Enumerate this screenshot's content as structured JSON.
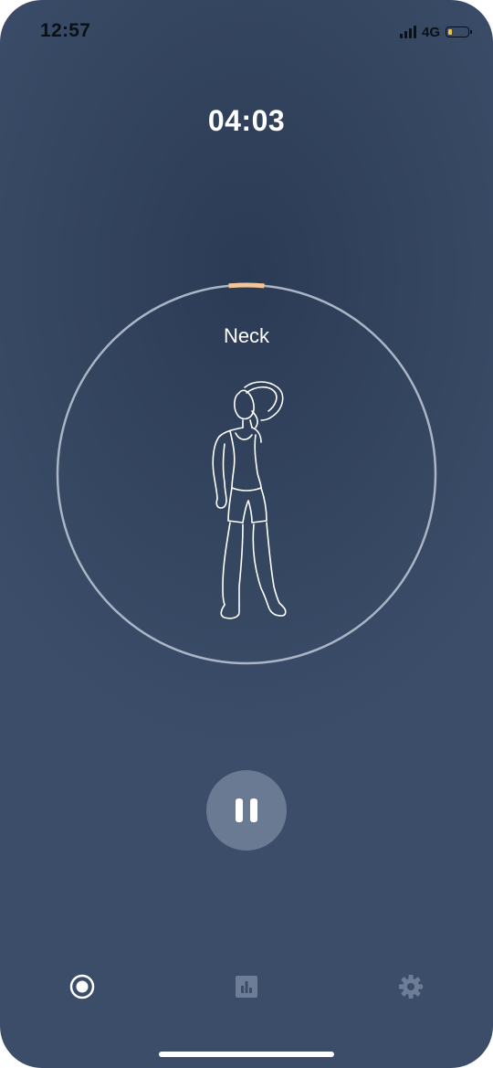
{
  "status_bar": {
    "time": "12:57",
    "network": "4G",
    "battery_color": "#e9c446"
  },
  "session": {
    "timer": "04:03",
    "exercise": "Neck",
    "progress_fraction": 0.03,
    "ring_color": "#aab5c6",
    "progress_color": "#f2c59a"
  },
  "controls": {
    "pause_icon": "pause-icon"
  },
  "tab_bar": {
    "tabs": [
      {
        "icon": "record-icon",
        "active": true
      },
      {
        "icon": "stats-icon",
        "active": false
      },
      {
        "icon": "gear-icon",
        "active": false
      }
    ],
    "active_color": "#ffffff",
    "inactive_color": "#6e7d97"
  }
}
